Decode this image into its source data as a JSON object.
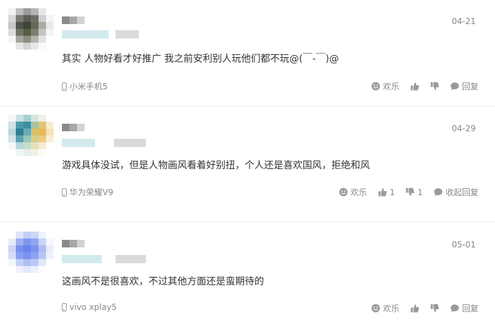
{
  "actions": {
    "laugh": "欢乐",
    "reply": "回复",
    "collapse_reply": "收起回复"
  },
  "comments": [
    {
      "date": "04-21",
      "text": "其实 人物好看才好推广 我之前安利别人玩他们都不玩@(￣-￣)@",
      "device": "小米手机5",
      "likes": "",
      "dislikes": ""
    },
    {
      "date": "04-29",
      "text": "游戏具体没试，但是人物画风看着好别扭，个人还是喜欢国风，拒绝和风",
      "device": "华为荣耀V9",
      "likes": "1",
      "dislikes": "1"
    },
    {
      "date": "05-01",
      "text": "这画风不是很喜欢，不过其他方面还是蛮期待的",
      "device": "vivo xplay5",
      "likes": "",
      "dislikes": ""
    }
  ],
  "colors": {
    "avatar1": [
      "#c9c9c9",
      "#8a8a8a",
      "#6d6d6d",
      "#9aa08a",
      "#d8d8d8",
      "#efefef"
    ],
    "avatar2": [
      "#8cc4c9",
      "#3f8fa0",
      "#d9c56a",
      "#e3b76a",
      "#b9d8a8",
      "#efefef"
    ],
    "avatar3": [
      "#b9c6f2",
      "#8b9ff0",
      "#6f89ee",
      "#9db0f3",
      "#d4dcf8",
      "#eef1fc"
    ],
    "name_blur": [
      "#8a8a8a",
      "#bdbdbd",
      "#d9d9d9"
    ],
    "meta_blur": [
      "#cfe9ec",
      "#e4f3f4",
      "#d7d7d7"
    ]
  }
}
